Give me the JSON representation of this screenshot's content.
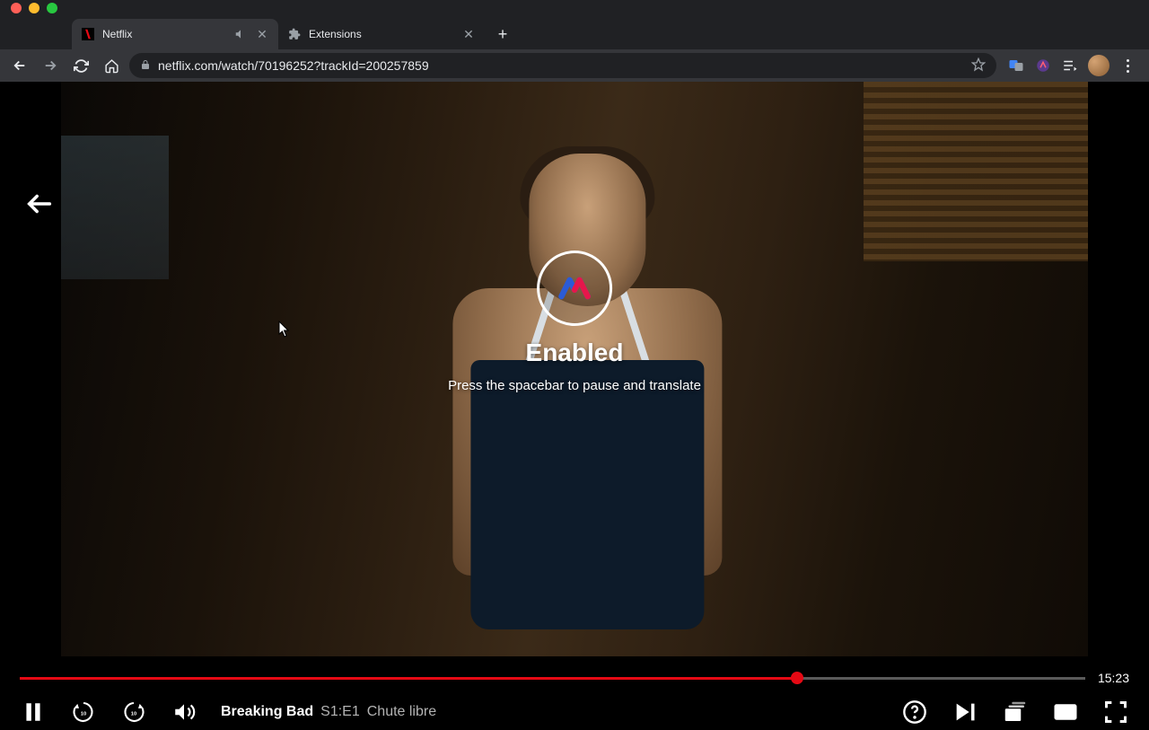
{
  "window": {
    "tabs": [
      {
        "title": "Netflix",
        "favicon": "netflix",
        "muted": true,
        "active": true
      },
      {
        "title": "Extensions",
        "favicon": "puzzle",
        "muted": false,
        "active": false
      }
    ]
  },
  "toolbar": {
    "url": "netflix.com/watch/70196252?trackId=200257859"
  },
  "overlay": {
    "title": "Enabled",
    "subtitle": "Press the spacebar to pause and translate"
  },
  "player": {
    "show_title": "Breaking Bad",
    "episode_code": "S1:E1",
    "episode_title": "Chute libre",
    "time_remaining": "15:23",
    "progress_percent": 73,
    "skip_back_seconds": "10",
    "skip_fwd_seconds": "10"
  }
}
